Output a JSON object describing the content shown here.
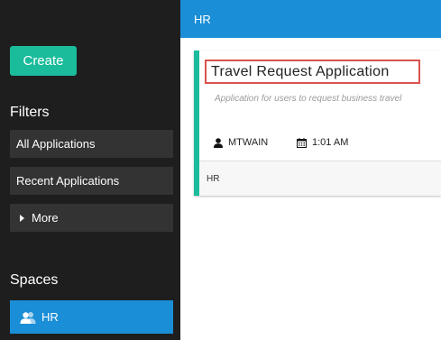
{
  "sidebar": {
    "create_label": "Create",
    "filters_title": "Filters",
    "filters": [
      {
        "label": "All Applications"
      },
      {
        "label": "Recent Applications"
      },
      {
        "label": "More"
      }
    ],
    "spaces_title": "Spaces",
    "spaces": [
      {
        "label": "HR",
        "icon": "users-icon"
      }
    ]
  },
  "header": {
    "title": "HR"
  },
  "card": {
    "title": "Travel Request Application",
    "description": "Application for users to request business travel",
    "owner": "MTWAIN",
    "owner_icon": "user-icon",
    "time": "1:01 AM",
    "time_icon": "calendar-icon",
    "space": "HR"
  },
  "colors": {
    "sidebar_bg": "#1e1e1e",
    "accent_teal": "#1abc9c",
    "accent_blue": "#1a8ed6",
    "highlight_red": "#d9534f"
  }
}
